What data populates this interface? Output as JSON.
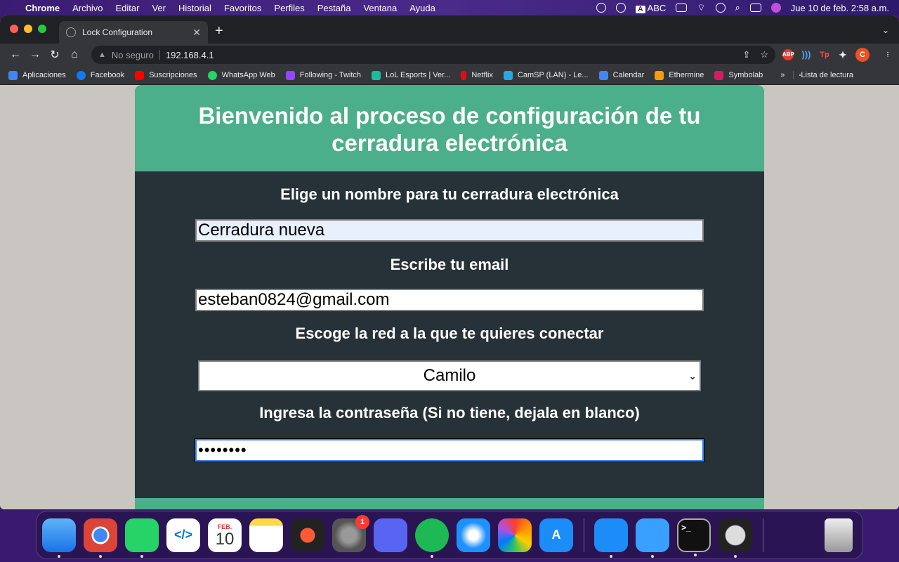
{
  "menubar": {
    "app": "Chrome",
    "items": [
      "Archivo",
      "Editar",
      "Ver",
      "Historial",
      "Favoritos",
      "Perfiles",
      "Pestaña",
      "Ventana",
      "Ayuda"
    ],
    "input_source": "ABC",
    "datetime": "Jue 10 de feb.  2:58 a.m."
  },
  "browser": {
    "tab_title": "Lock Configuration",
    "security_label": "No seguro",
    "url": "192.168.4.1",
    "profile_initial": "C",
    "bookmarks": [
      {
        "label": "Aplicaciones",
        "color": "#4285f4"
      },
      {
        "label": "Facebook",
        "color": "#1877f2"
      },
      {
        "label": "Suscripciones",
        "color": "#ff0000"
      },
      {
        "label": "WhatsApp Web",
        "color": "#25d366"
      },
      {
        "label": "Following - Twitch",
        "color": "#9146ff"
      },
      {
        "label": "LoL Esports | Ver...",
        "color": "#1abc9c"
      },
      {
        "label": "Netflix",
        "color": "#e50914"
      },
      {
        "label": "CamSP (LAN) - Le...",
        "color": "#29a8e0"
      },
      {
        "label": "Calendar",
        "color": "#4285f4"
      },
      {
        "label": "Ethermine",
        "color": "#f39c12"
      },
      {
        "label": "Symbolab",
        "color": "#d81b60"
      }
    ],
    "bookmarks_more": "»",
    "reading_list": "Lista de lectura"
  },
  "page": {
    "title": "Bienvenido al proceso de configuración de tu cerradura electrónica",
    "name_label": "Elige un nombre para tu cerradura electrónica",
    "name_value": "Cerradura nueva",
    "email_label": "Escribe tu email",
    "email_value": "esteban0824@gmail.com",
    "network_label": "Escoge la red a la que te quieres conectar",
    "network_value": "Camilo",
    "password_label": "Ingresa la contraseña (Si no tiene, dejala en blanco)",
    "password_value": "••••••••"
  },
  "dock": {
    "calendar_month": "FEB.",
    "calendar_day": "10",
    "settings_badge": "1"
  }
}
